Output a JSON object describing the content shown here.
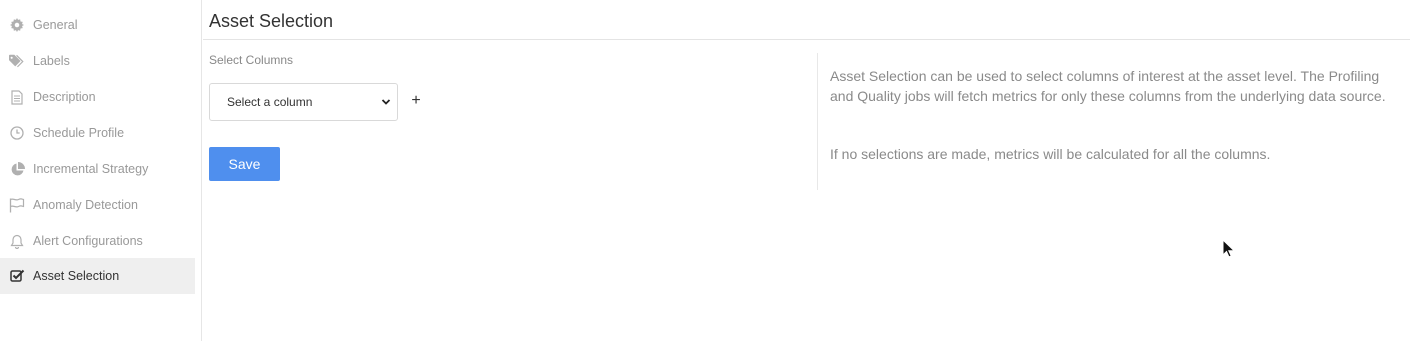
{
  "sidebar": {
    "items": [
      {
        "label": "General",
        "icon": "gear-icon",
        "active": false
      },
      {
        "label": "Labels",
        "icon": "tags-icon",
        "active": false
      },
      {
        "label": "Description",
        "icon": "document-icon",
        "active": false
      },
      {
        "label": "Schedule Profile",
        "icon": "clock-icon",
        "active": false
      },
      {
        "label": "Incremental Strategy",
        "icon": "pie-chart-icon",
        "active": false
      },
      {
        "label": "Anomaly Detection",
        "icon": "flag-icon",
        "active": false
      },
      {
        "label": "Alert Configurations",
        "icon": "bell-icon",
        "active": false
      },
      {
        "label": "Asset Selection",
        "icon": "checkbox-checked-icon",
        "active": true
      }
    ]
  },
  "header": {
    "title": "Asset Selection"
  },
  "form": {
    "columns_label": "Select Columns",
    "column_select_value": "Select a column",
    "add_label": "+",
    "save_label": "Save"
  },
  "help": {
    "paragraph1": "Asset Selection can be used to select columns of interest at the asset level. The Profiling and Quality jobs will fetch metrics for only these columns from the underlying data source.",
    "paragraph2": "If no selections are made, metrics will be calculated for all the columns."
  },
  "colors": {
    "accent": "#4f8fee",
    "active_bg": "#efefef"
  }
}
